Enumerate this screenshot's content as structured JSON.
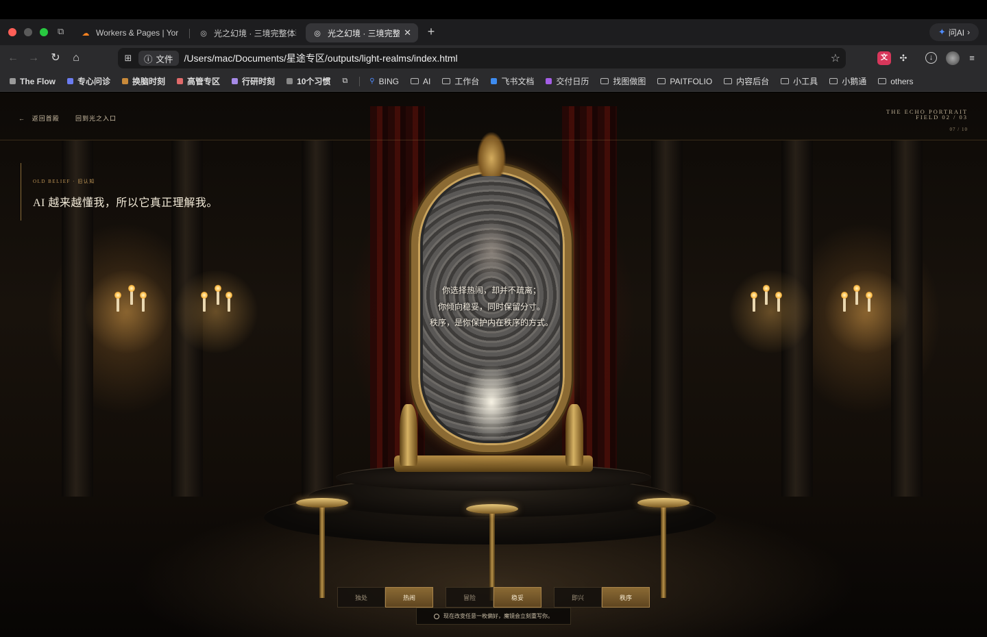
{
  "browser": {
    "tabs": [
      {
        "label": "Workers & Pages | Yor",
        "favicon": "cloudflare-icon"
      },
      {
        "label": "光之幻境 · 三境完整体验",
        "favicon": "globe-icon"
      },
      {
        "label": "光之幻境 · 三境完整",
        "favicon": "globe-icon",
        "active": true
      }
    ],
    "ask_ai": "问AI",
    "file_chip": "文件",
    "url": "/Users/mac/Documents/星途专区/outputs/light-realms/index.html",
    "bookmarks": [
      {
        "label": "The Flow",
        "kind": "dot",
        "color": "#9a9a9a"
      },
      {
        "label": "专心问诊",
        "kind": "dot",
        "color": "#6b7cf0"
      },
      {
        "label": "换脑时刻",
        "kind": "dot",
        "color": "#c98a3a"
      },
      {
        "label": "高管专区",
        "kind": "dot",
        "color": "#e06a6a"
      },
      {
        "label": "行研时刻",
        "kind": "dot",
        "color": "#a58ae6"
      },
      {
        "label": "10个习惯",
        "kind": "dot",
        "color": "#888888"
      }
    ],
    "bookmarks_more": [
      {
        "label": "BING",
        "kind": "search"
      },
      {
        "label": "AI",
        "kind": "folder"
      },
      {
        "label": "工作台",
        "kind": "folder"
      },
      {
        "label": "飞书文档",
        "kind": "app"
      },
      {
        "label": "交付日历",
        "kind": "app"
      },
      {
        "label": "找图做图",
        "kind": "folder"
      },
      {
        "label": "PAITFOLIO",
        "kind": "folder"
      },
      {
        "label": "内容后台",
        "kind": "folder"
      },
      {
        "label": "小工具",
        "kind": "folder"
      },
      {
        "label": "小鹅通",
        "kind": "folder"
      },
      {
        "label": "others",
        "kind": "folder"
      }
    ]
  },
  "page": {
    "nav": {
      "back_label": "返回首殿",
      "portal_label": "回到光之入口"
    },
    "portrait": {
      "title_line1": "THE ECHO PORTRAIT",
      "title_line2": "FIELD 02 / 03",
      "count": "07 / 10"
    },
    "belief": {
      "tag": "OLD BELIEF · 旧认知",
      "text": "AI 越来越懂我，所以它真正理解我。"
    },
    "mirror_lines": [
      "你选择热闹，却并不疏离；",
      "你倾向稳妥，同时保留分寸。",
      "秩序，是你保护内在秩序的方式。"
    ],
    "choice_groups": [
      {
        "options": [
          "独处",
          "热闹"
        ],
        "selected": "热闹"
      },
      {
        "options": [
          "冒险",
          "稳妥"
        ],
        "selected": "稳妥"
      },
      {
        "options": [
          "即兴",
          "秩序"
        ],
        "selected": "秩序"
      }
    ],
    "hint": "现在改变任意一枚偏好，魔镜会立刻重写你。"
  }
}
